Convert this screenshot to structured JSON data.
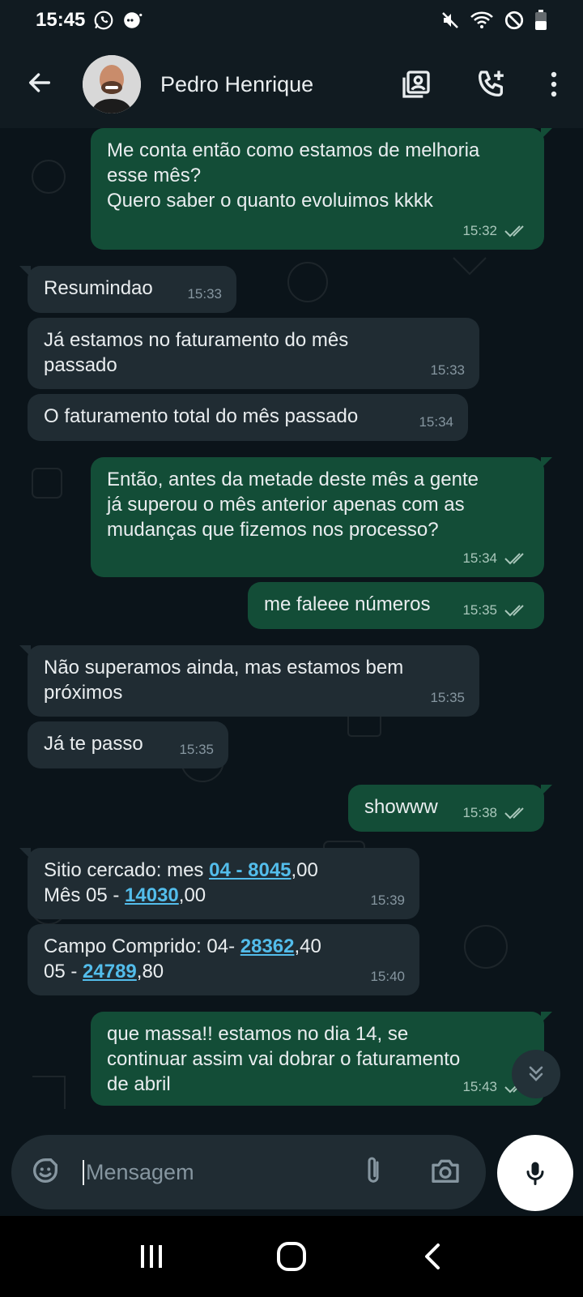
{
  "status_bar": {
    "time": "15:45",
    "icons": [
      "whatsapp-icon",
      "messenger-icon",
      "mute-icon",
      "wifi-icon",
      "do-not-disturb-icon",
      "battery-icon"
    ]
  },
  "header": {
    "back_icon": "arrow-left-icon",
    "contact_name": "Pedro Henrique",
    "actions": [
      "contact-card-icon",
      "add-call-icon",
      "more-vert-icon"
    ]
  },
  "messages": [
    {
      "dir": "out",
      "text": "Me conta então como estamos de melhoria\nesse mês?\nQuero saber o quanto evoluimos kkkk",
      "time": "15:32",
      "status": "read"
    },
    {
      "dir": "in",
      "text": "Resumindao",
      "time": "15:33"
    },
    {
      "dir": "in",
      "text": "Já estamos no faturamento do mês\npassado",
      "time": "15:33"
    },
    {
      "dir": "in",
      "text": "O faturamento total do mês passado",
      "time": "15:34"
    },
    {
      "dir": "out",
      "text": "Então, antes da metade deste mês a gente\njá superou o mês anterior apenas com as\nmudanças que fizemos nos processo?",
      "time": "15:34",
      "status": "read"
    },
    {
      "dir": "out",
      "text": "me faleee números",
      "time": "15:35",
      "status": "read"
    },
    {
      "dir": "in",
      "text": "Não superamos ainda, mas estamos bem\npróximos",
      "time": "15:35"
    },
    {
      "dir": "in",
      "text": "Já te passo",
      "time": "15:35"
    },
    {
      "dir": "out",
      "text": "showww",
      "time": "15:38",
      "status": "read"
    },
    {
      "dir": "in",
      "time": "15:39",
      "line1_prefix": "Sitio cercado: mes ",
      "line1_link": "04 - 8045",
      "line1_suffix": ",00",
      "line2_prefix": "Mês 05 - ",
      "line2_link": "14030",
      "line2_suffix": ",00"
    },
    {
      "dir": "in",
      "time": "15:40",
      "line1_prefix": "Campo Comprido: 04- ",
      "line1_link": "28362",
      "line1_suffix": ",40",
      "line2_prefix": "05 - ",
      "line2_link": "24789",
      "line2_suffix": ",80"
    },
    {
      "dir": "out",
      "text": "que massa!! estamos no dia 14, se\ncontinuar assim vai dobrar o faturamento\nde abril",
      "time": "15:43",
      "status": "read"
    }
  ],
  "input": {
    "placeholder": "Mensagem",
    "left_icon": "sticker-icon",
    "right_icons": [
      "attach-icon",
      "camera-icon"
    ],
    "mic_icon": "mic-icon"
  },
  "nav_bar": {
    "buttons": [
      "recents-icon",
      "home-icon",
      "back-icon"
    ]
  },
  "colors": {
    "outgoing_bubble": "#134d37",
    "incoming_bubble": "#202c33",
    "link": "#53bdeb",
    "background": "#0b141a"
  }
}
